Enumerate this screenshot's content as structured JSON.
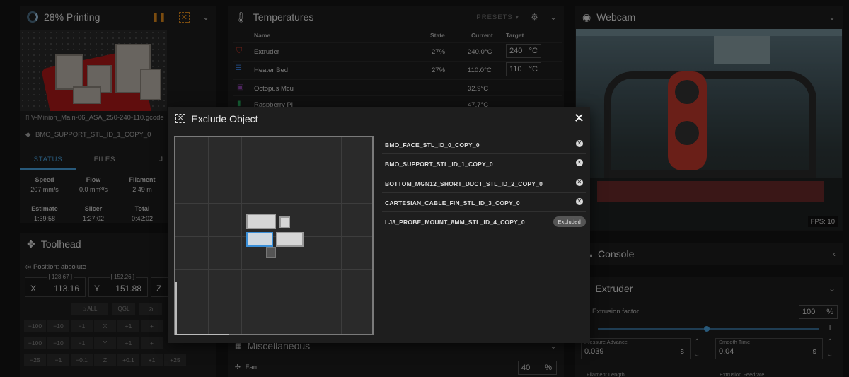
{
  "printing": {
    "title": "28% Printing",
    "filename": "V-Minion_Main-06_ASA_250-240-110.gcode",
    "current_object": "BMO_SUPPORT_STL_ID_1_COPY_0",
    "tabs": [
      "STATUS",
      "FILES",
      "J"
    ],
    "stats": [
      {
        "label": "Speed",
        "value": "207 mm/s"
      },
      {
        "label": "Flow",
        "value": "0.0 mm³/s"
      },
      {
        "label": "Filament",
        "value": "2.49 m"
      },
      {
        "label": "Estimate",
        "value": "1:39:58"
      },
      {
        "label": "Slicer",
        "value": "1:27:02"
      },
      {
        "label": "Total",
        "value": "0:42:02"
      }
    ]
  },
  "toolhead": {
    "title": "Toolhead",
    "position_label": "Position: absolute",
    "x": {
      "axis": "X",
      "value": "113.16",
      "hint": "[ 128.67 ]"
    },
    "y": {
      "axis": "Y",
      "value": "151.88",
      "hint": "[ 152.26 ]"
    },
    "z": {
      "axis": "Z"
    },
    "home": [
      "ALL",
      "QGL"
    ],
    "row1": [
      "−100",
      "−10",
      "−1",
      "X",
      "+1",
      "+"
    ],
    "row2": [
      "−100",
      "−10",
      "−1",
      "Y",
      "+1",
      "+"
    ],
    "row3": [
      "−25",
      "−1",
      "−0.1",
      "Z",
      "+0.1",
      "+1",
      "+25"
    ]
  },
  "temperatures": {
    "title": "Temperatures",
    "presets": "PRESETS",
    "headers": {
      "name": "Name",
      "state": "State",
      "current": "Current",
      "target": "Target"
    },
    "rows": [
      {
        "name": "Extruder",
        "state": "27%",
        "current": "240.0°C",
        "target": "240",
        "unit": "°C"
      },
      {
        "name": "Heater Bed",
        "state": "27%",
        "current": "110.0°C",
        "target": "110",
        "unit": "°C"
      },
      {
        "name": "Octopus Mcu",
        "state": "",
        "current": "32.9°C"
      },
      {
        "name": "Raspberry Pi",
        "state": "",
        "current": "47.7°C"
      }
    ]
  },
  "misc": {
    "title": "Miscellaneous",
    "fan_label": "Fan",
    "fan_value": "40",
    "fan_unit": "%"
  },
  "webcam": {
    "title": "Webcam",
    "fps": "FPS: 10"
  },
  "console": {
    "title": "Console"
  },
  "extruder": {
    "title": "Extruder",
    "factor_label": "Extrusion factor",
    "factor_value": "100",
    "factor_unit": "%",
    "factor_fraction": 0.5,
    "pa_label": "Pressure Advance",
    "pa_value": "0.039",
    "pa_unit": "s",
    "st_label": "Smooth Time",
    "st_value": "0.04",
    "st_unit": "s",
    "fl_label": "Filament Length",
    "ef_label": "Extrusion Feedrate"
  },
  "dialog": {
    "title": "Exclude Object",
    "close": "✕",
    "objects": [
      {
        "name": "BMO_FACE_STL_ID_0_COPY_0",
        "excluded": false
      },
      {
        "name": "BMO_SUPPORT_STL_ID_1_COPY_0",
        "excluded": false
      },
      {
        "name": "BOTTOM_MGN12_SHORT_DUCT_STL_ID_2_COPY_0",
        "excluded": false
      },
      {
        "name": "CARTESIAN_CABLE_FIN_STL_ID_3_COPY_0",
        "excluded": false
      },
      {
        "name": "LJ8_PROBE_MOUNT_8MM_STL_ID_4_COPY_0",
        "excluded": true
      }
    ],
    "excluded_badge": "Excluded"
  }
}
